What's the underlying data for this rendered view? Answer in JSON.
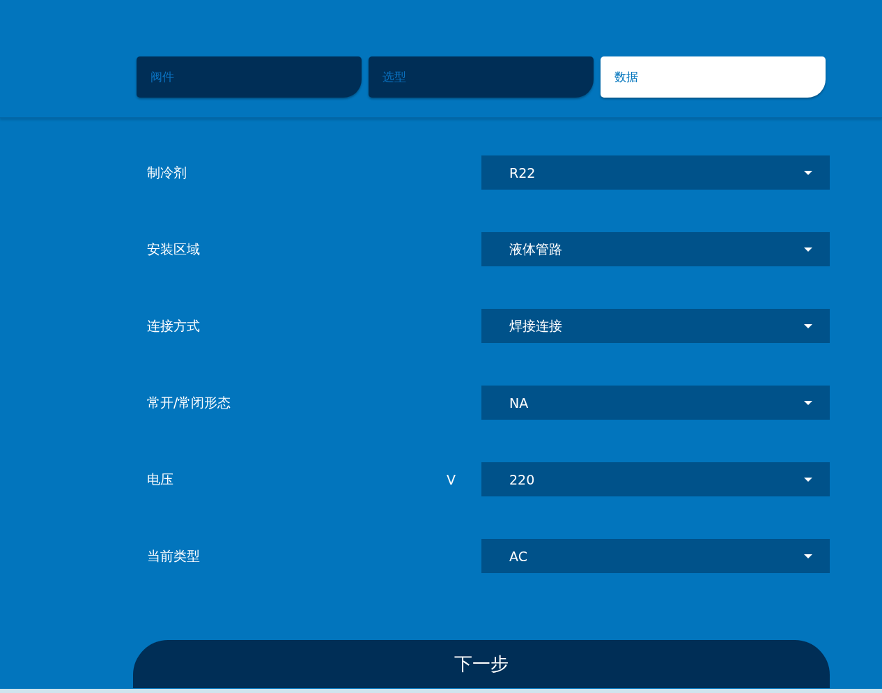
{
  "tabs": [
    {
      "label": "阀件",
      "selected": false
    },
    {
      "label": "选型",
      "selected": false
    },
    {
      "label": "数据",
      "selected": true
    }
  ],
  "rows": [
    {
      "label": "制冷剂",
      "value": "R22"
    },
    {
      "label": "安装区域",
      "value": "液体管路"
    },
    {
      "label": "连接方式",
      "value": "焊接连接"
    },
    {
      "label": "常开/常闭形态",
      "value": "NA"
    },
    {
      "label": "电压",
      "unit": "V",
      "value": "220"
    },
    {
      "label": "当前类型",
      "value": "AC"
    }
  ],
  "next_button": "下一步"
}
